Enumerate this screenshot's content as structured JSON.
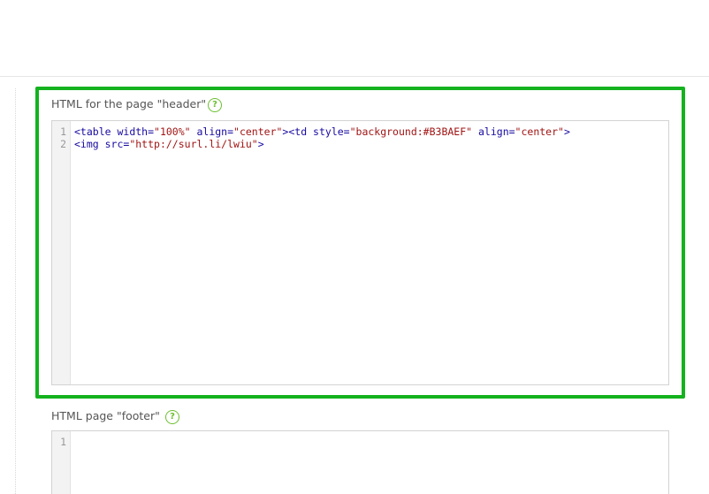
{
  "header_field": {
    "label": "HTML for the page \"header\"",
    "help_icon": "help-circle-icon",
    "help_glyph": "?",
    "highlight_color": "#14b21e",
    "line_numbers": [
      "1",
      "2"
    ],
    "code": {
      "line1": {
        "t1": "<table",
        "a1": " width=",
        "v1": "\"100%\"",
        "a2": " align=",
        "v2": "\"center\"",
        "t2": "><td",
        "a3": " style=",
        "v3": "\"background:#B3BAEF\"",
        "a4": " align=",
        "v4": "\"center\"",
        "t3": ">"
      },
      "line2": {
        "t1": "<img",
        "a1": " src=",
        "v1": "\"http://surl.li/lwiu\"",
        "t2": ">"
      }
    }
  },
  "footer_field": {
    "label": "HTML page \"footer\"",
    "help_icon": "help-circle-icon",
    "help_glyph": "?",
    "line_numbers": [
      "1"
    ]
  }
}
